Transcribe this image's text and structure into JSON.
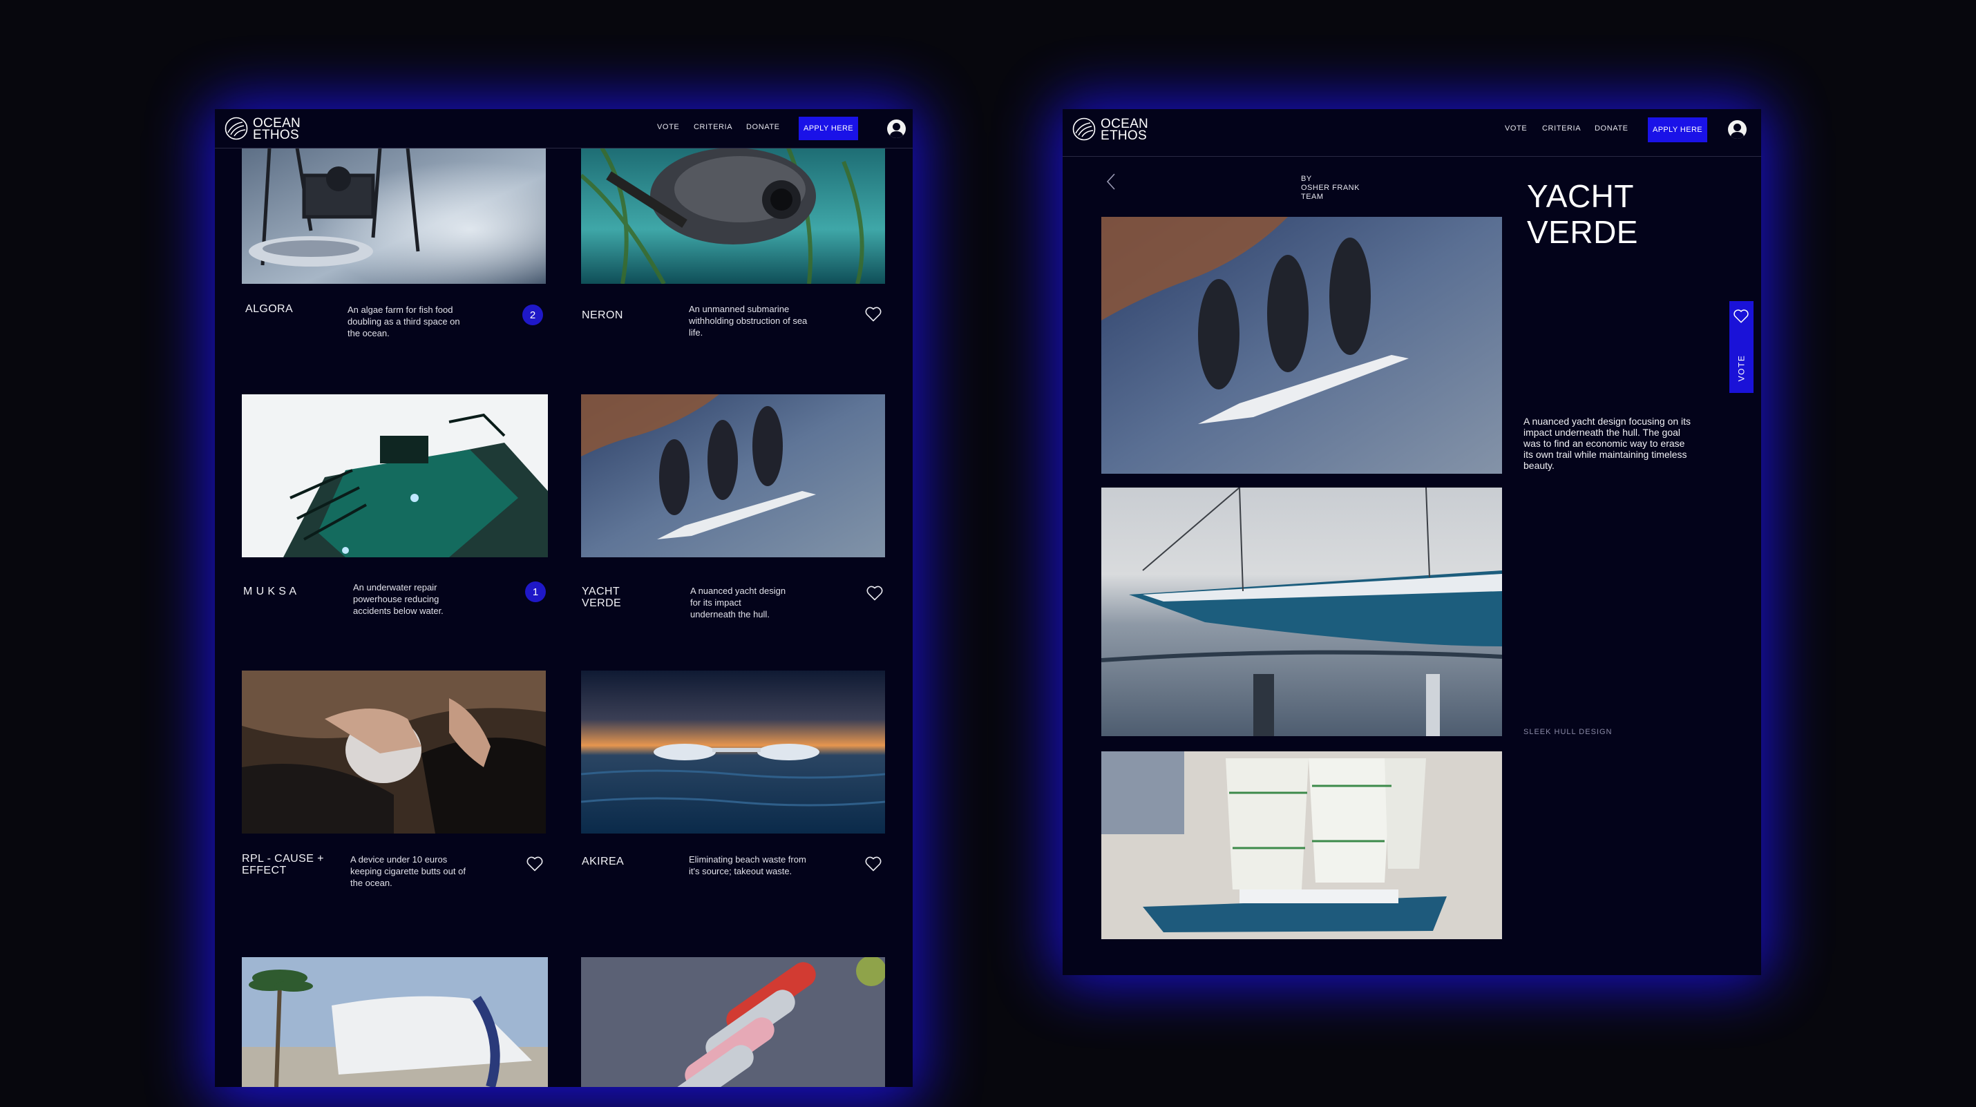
{
  "brand": {
    "logo_text": "OCEAN\nETHOS"
  },
  "nav": {
    "vote": "VOTE",
    "criteria": "CRITERIA",
    "donate": "DONATE",
    "apply": "APPLY HERE"
  },
  "gallery": {
    "cards": [
      {
        "title": "ALGORA",
        "description": "An algae farm for fish food doubling as a third space on the ocean.",
        "votes": "2"
      },
      {
        "title": "NERON",
        "description": "An unmanned submarine withholding obstruction of sea life.",
        "votes": null
      },
      {
        "title": "M U K S A",
        "description": "An underwater repair powerhouse reducing accidents below water.",
        "votes": "1"
      },
      {
        "title": "YACHT\nVERDE",
        "description": "A nuanced yacht design for its impact underneath the hull.",
        "votes": null
      },
      {
        "title": "RPL - CAUSE +\nEFFECT",
        "description": "A device under 10 euros keeping cigarette butts out of the ocean.",
        "votes": null
      },
      {
        "title": "AKIREA",
        "description": "Eliminating beach waste from it's source; takeout waste.",
        "votes": null
      }
    ]
  },
  "detail": {
    "by_line": "BY\nOSHER FRANK\nTEAM",
    "title": "YACHT\nVERDE",
    "description": "A nuanced yacht design focusing on its impact underneath the hull. The goal was to find an economic way to erase its own trail while maintaining timeless beauty.",
    "image_caption": "SLEEK HULL DESIGN",
    "vote_label": "VOTE"
  },
  "colors": {
    "background": "#07070d",
    "panel": "#03031a",
    "accent": "#1a12e8",
    "glow": "#1a10d8"
  }
}
